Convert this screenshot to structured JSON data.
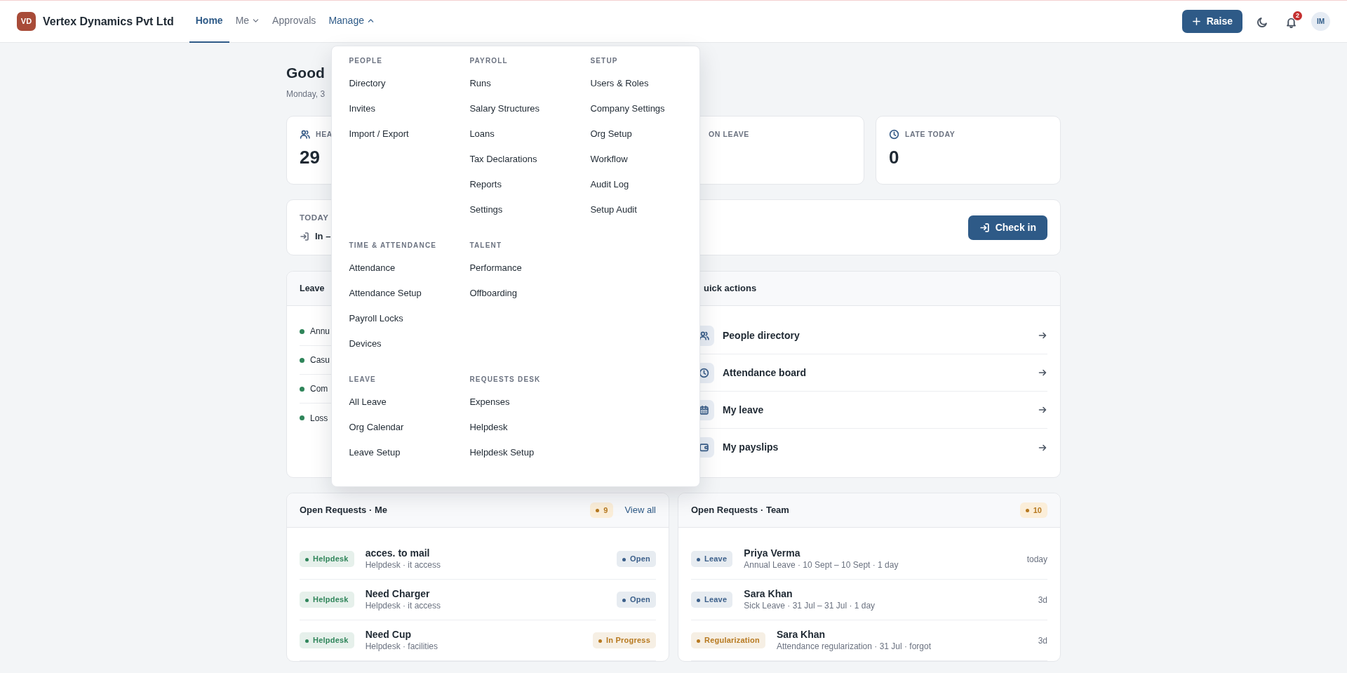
{
  "nav": {
    "logo": "VD",
    "brand": "Vertex Dynamics Pvt Ltd",
    "items": [
      {
        "label": "Home",
        "selected": true
      },
      {
        "label": "Me",
        "selected": false,
        "expanded": false
      },
      {
        "label": "Approvals",
        "selected": false
      },
      {
        "label": "Manage",
        "selected": false,
        "expanded": true
      }
    ],
    "raise_button": "Raise",
    "notification_count": "2",
    "avatar": "IM"
  },
  "greeting": {
    "title": "Good",
    "date": "Monday, 3"
  },
  "stats": [
    {
      "label": "HEA",
      "value": "29"
    },
    {
      "label": "ON LEAVE"
    },
    {
      "label": "LATE TODAY",
      "value": "0"
    }
  ],
  "today": {
    "label": "TODAY",
    "status": "In –",
    "button": "Check in"
  },
  "leave_card": {
    "title": "Leave",
    "items": [
      "Annu",
      "Casu",
      "Com",
      "Loss"
    ]
  },
  "quick_actions": {
    "title": "uick actions",
    "items": [
      "People directory",
      "Attendance board",
      "My leave",
      "My payslips"
    ]
  },
  "open_requests_me": {
    "title": "Open Requests · Me",
    "count": "9",
    "view_all": "View all",
    "rows": [
      {
        "tag": {
          "label": "Helpdesk",
          "color": "#2f855a"
        },
        "title": "acces. to mail",
        "subtitle": "Helpdesk · it access",
        "status": {
          "label": "Open",
          "color": "#3b5f8a"
        }
      },
      {
        "tag": {
          "label": "Helpdesk",
          "color": "#2f855a"
        },
        "title": "Need Charger",
        "subtitle": "Helpdesk · it access",
        "status": {
          "label": "Open",
          "color": "#3b5f8a"
        }
      },
      {
        "tag": {
          "label": "Helpdesk",
          "color": "#2f855a"
        },
        "title": "Need Cup",
        "subtitle": "Helpdesk · facilities",
        "status": {
          "label": "In Progress",
          "color": "#b7791f"
        }
      }
    ]
  },
  "open_requests_team": {
    "title": "Open Requests · Team",
    "count": "10",
    "rows": [
      {
        "tag": {
          "label": "Leave",
          "color": "#3b5f8a"
        },
        "name": "Priya Verma",
        "detail": "Annual Leave · 10 Sept – 10 Sept · 1 day",
        "age": "today"
      },
      {
        "tag": {
          "label": "Leave",
          "color": "#3b5f8a"
        },
        "name": "Sara Khan",
        "detail": "Sick Leave · 31 Jul – 31 Jul · 1 day",
        "age": "3d"
      },
      {
        "tag": {
          "label": "Regularization",
          "color": "#b7791f"
        },
        "name": "Sara Khan",
        "detail": "Attendance regularization · 31 Jul · forgot",
        "age": "3d"
      }
    ]
  },
  "manage_menu": {
    "sections": [
      {
        "title": "PEOPLE",
        "items": [
          "Directory",
          "Invites",
          "Import / Export"
        ]
      },
      {
        "title": "PAYROLL",
        "items": [
          "Runs",
          "Salary Structures",
          "Loans",
          "Tax Declarations",
          "Reports",
          "Settings"
        ]
      },
      {
        "title": "SETUP",
        "items": [
          "Users & Roles",
          "Company Settings",
          "Org Setup",
          "Workflow",
          "Audit Log",
          "Setup Audit"
        ]
      },
      {
        "title": "TIME & ATTENDANCE",
        "items": [
          "Attendance",
          "Attendance Setup",
          "Payroll Locks",
          "Devices"
        ]
      },
      {
        "title": "TALENT",
        "items": [
          "Performance",
          "Offboarding"
        ]
      },
      {
        "title": "LEAVE",
        "items": [
          "All Leave",
          "Org Calendar",
          "Leave Setup"
        ]
      },
      {
        "title": "REQUESTS DESK",
        "items": [
          "Expenses",
          "Helpdesk",
          "Helpdesk Setup"
        ]
      }
    ]
  }
}
